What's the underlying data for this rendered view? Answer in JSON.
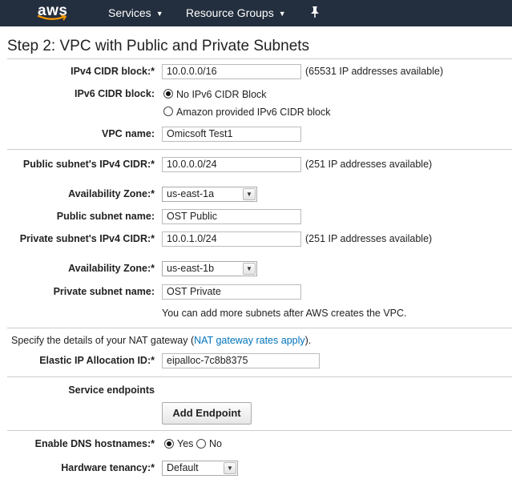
{
  "nav": {
    "logo": "aws",
    "services": "Services",
    "resource_groups": "Resource Groups"
  },
  "page_title": "Step 2: VPC with Public and Private Subnets",
  "ipv4_cidr": {
    "label": "IPv4 CIDR block:*",
    "value": "10.0.0.0/16",
    "note": "(65531 IP addresses available)"
  },
  "ipv6_cidr": {
    "label": "IPv6 CIDR block:",
    "option1": "No IPv6 CIDR Block",
    "option2": "Amazon provided IPv6 CIDR block",
    "selected": "option1"
  },
  "vpc_name": {
    "label": "VPC name:",
    "value": "Omicsoft Test1"
  },
  "public_cidr": {
    "label": "Public subnet's IPv4 CIDR:*",
    "value": "10.0.0.0/24",
    "note": "(251 IP addresses available)"
  },
  "az1": {
    "label": "Availability Zone:*",
    "value": "us-east-1a"
  },
  "public_name": {
    "label": "Public subnet name:",
    "value": "OST Public"
  },
  "private_cidr": {
    "label": "Private subnet's IPv4 CIDR:*",
    "value": "10.0.1.0/24",
    "note": "(251 IP addresses available)"
  },
  "az2": {
    "label": "Availability Zone:*",
    "value": "us-east-1b"
  },
  "private_name": {
    "label": "Private subnet name:",
    "value": "OST Private"
  },
  "subnet_hint": "You can add more subnets after AWS creates the VPC.",
  "nat": {
    "prefix": "Specify the details of your NAT gateway (",
    "link": "NAT gateway rates apply",
    "suffix": ")."
  },
  "eip": {
    "label": "Elastic IP Allocation ID:*",
    "value": "eipalloc-7c8b8375"
  },
  "endpoints": {
    "label": "Service endpoints",
    "button": "Add Endpoint"
  },
  "dns": {
    "label": "Enable DNS hostnames:*",
    "yes": "Yes",
    "no": "No",
    "selected": "yes"
  },
  "tenancy": {
    "label": "Hardware tenancy:*",
    "value": "Default"
  }
}
